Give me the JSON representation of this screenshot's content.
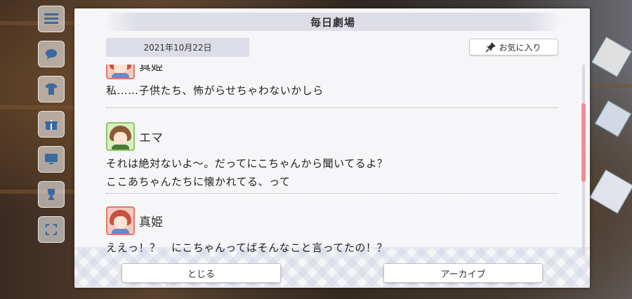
{
  "dialog": {
    "title": "毎日劇場",
    "date": "2021年10月22日",
    "favorite_label": "お気に入り",
    "close_label": "とじる",
    "archive_label": "アーカイブ"
  },
  "entries": [
    {
      "speaker": "真姫",
      "avatar": "maki-avatar",
      "lines": [
        "私……子供たち、怖がらせちゃわないかしら"
      ]
    },
    {
      "speaker": "エマ",
      "avatar": "emma-avatar",
      "lines": [
        "それは絶対ないよ〜。だってにこちゃんから聞いてるよ？",
        "ここあちゃんたちに懐かれてる、って"
      ]
    },
    {
      "speaker": "真姫",
      "avatar": "maki-avatar",
      "lines": [
        "ええっ！？　にこちゃんってばそんなこと言ってたの！？"
      ]
    }
  ],
  "colors": {
    "scroll_thumb": "#ef8c94",
    "title_bar": "#dcdde6",
    "dialog_bg": "#f6f6f8"
  },
  "icons": {
    "favorite": "pin-icon",
    "menu": "hamburger-icon"
  }
}
